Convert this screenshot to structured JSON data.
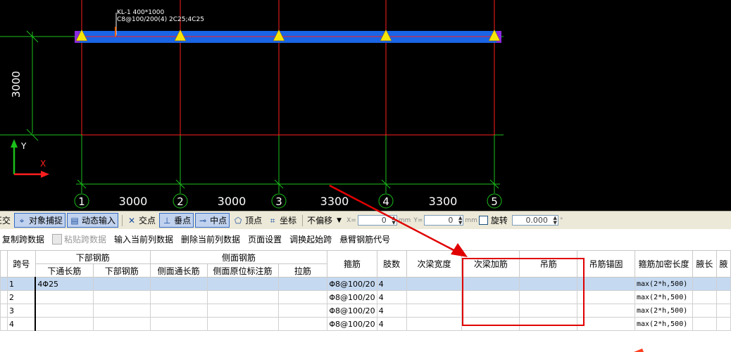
{
  "canvas": {
    "beam_label_line1": "KL-1 400*1000",
    "beam_label_line2": "C8@100/200(4) 2C25;4C25",
    "vertical_dim": "3000",
    "axis_y": "Y",
    "axis_x": "X",
    "axes": [
      {
        "num": "1",
        "span_after": "3000"
      },
      {
        "num": "2",
        "span_after": "3000"
      },
      {
        "num": "3",
        "span_after": "3300"
      },
      {
        "num": "4",
        "span_after": "3300"
      },
      {
        "num": "5",
        "span_after": ""
      }
    ],
    "colors": {
      "background": "#000000",
      "beam": "#1a64e6",
      "grid": "#1bbf1b",
      "frame": "#ff1e1e",
      "support": "#f5e60a"
    }
  },
  "snapbar": {
    "ortho": "正交",
    "object_snap": "对象捕捉",
    "dynamic_input": "动态输入",
    "intersection": "交点",
    "perpendicular": "垂点",
    "midpoint": "中点",
    "vertex": "顶点",
    "coordinate": "坐标",
    "offset_mode": "不偏移",
    "x_label": "X=",
    "x_value": "0",
    "y_label": "Y=",
    "y_value": "0",
    "unit": "mm",
    "rotate_label": "旋转",
    "rotate_value": "0.000",
    "degree": "°"
  },
  "toolbar2": {
    "copy_span": "复制跨数据",
    "paste_span": "粘贴跨数据",
    "input_column": "输入当前列数据",
    "delete_column": "删除当前列数据",
    "page_setup": "页面设置",
    "swap_start": "调换起始跨",
    "cantilever_code": "悬臂钢筋代号"
  },
  "table": {
    "group_bottom": "下部钢筋",
    "group_side": "侧面钢筋",
    "headers": {
      "span_no": "跨号",
      "bottom_through": "下通长筋",
      "bottom_rebar": "下部钢筋",
      "side_through": "侧面通长筋",
      "side_original": "侧面原位标注筋",
      "tie_bar": "拉筋",
      "stirrup": "箍筋",
      "legs": "肢数",
      "sec_beam_width": "次梁宽度",
      "sec_beam_rebar": "次梁加筋",
      "hanger": "吊筋",
      "hanger_anchor": "吊筋锚固",
      "stirrup_dense_len": "箍筋加密长度",
      "haunch_len": "腋长",
      "extra": "腋"
    },
    "rows": [
      {
        "span": "1",
        "bottom_through": "4Φ25",
        "stirrup": "Φ8@100/20",
        "legs": "4",
        "dense": "max(2*h,500)"
      },
      {
        "span": "2",
        "bottom_through": "",
        "stirrup": "Φ8@100/20",
        "legs": "4",
        "dense": "max(2*h,500)"
      },
      {
        "span": "3",
        "bottom_through": "",
        "stirrup": "Φ8@100/20",
        "legs": "4",
        "dense": "max(2*h,500)"
      },
      {
        "span": "4",
        "bottom_through": "",
        "stirrup": "Φ8@100/20",
        "legs": "4",
        "dense": "max(2*h,500)"
      }
    ]
  },
  "annotation": {
    "highlight_color": "#e00000"
  }
}
